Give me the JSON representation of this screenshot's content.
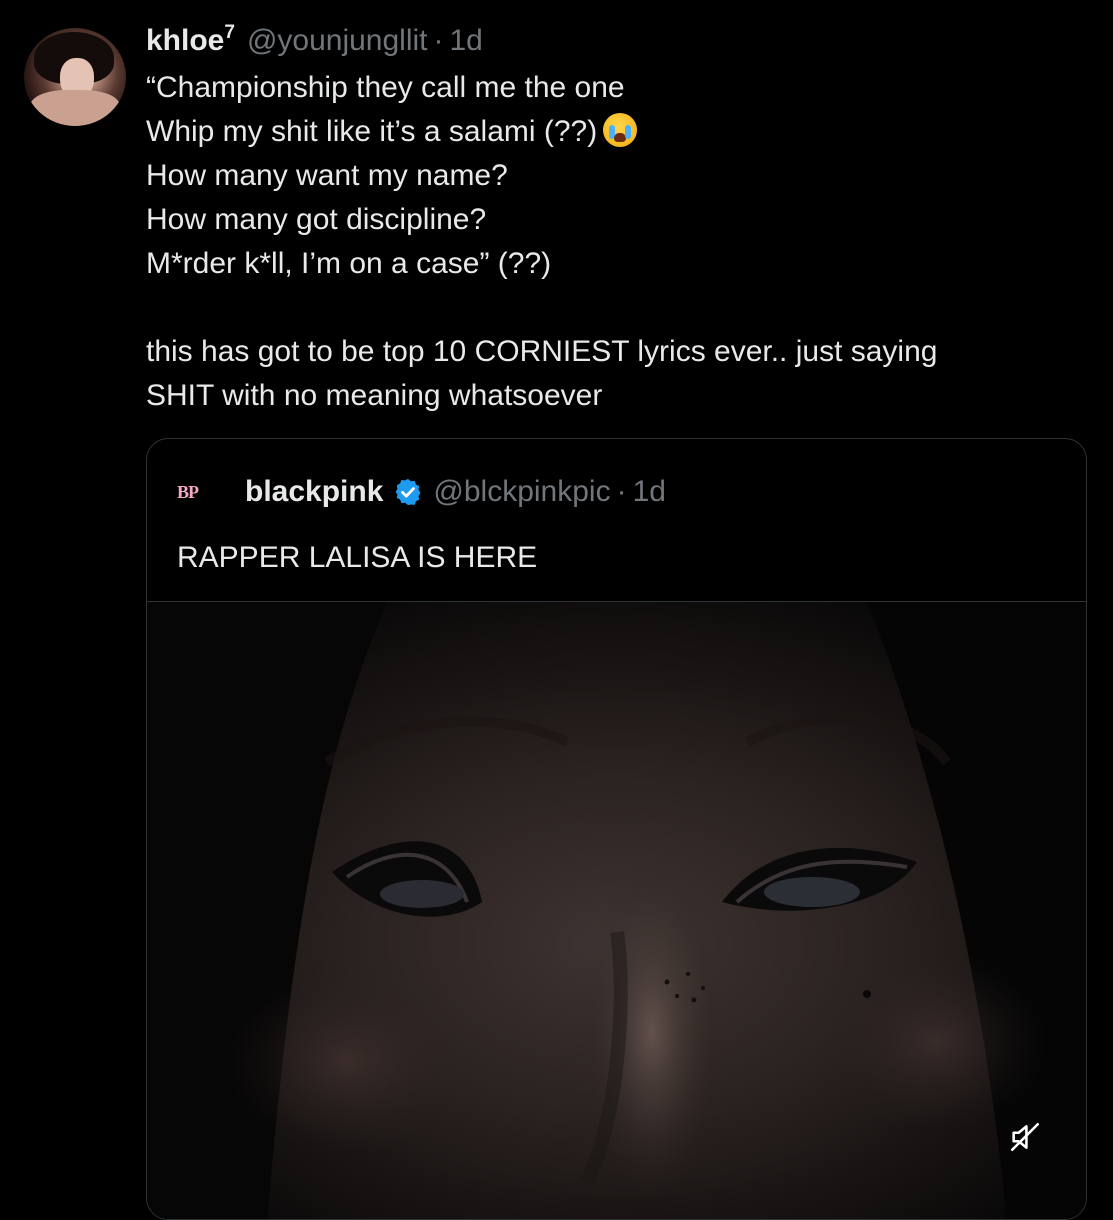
{
  "tweet": {
    "author": {
      "display_name": "khloe",
      "display_name_sup": "7",
      "handle": "@younjungllit",
      "separator": "·",
      "time": "1d",
      "avatar": "profile-photo"
    },
    "lines": [
      "“Championship they call me the one",
      "Whip my shit like it’s a salami (??)",
      "How many want my name?",
      "How many got discipline?",
      "M*rder k*ll, I’m on a case” (??)"
    ],
    "line2_emoji": "loudly-crying-face-emoji",
    "paragraph2": [
      "this has got to be top 10 CORNIEST lyrics ever.. just saying",
      "SHIT with no meaning whatsoever"
    ]
  },
  "quote": {
    "logo_text": "BP",
    "display_name": "blackpink",
    "verified_icon": "verified-badge-icon",
    "verified_color": "#1d9bf0",
    "handle": "@blckpinkpic",
    "separator": "·",
    "time": "1d",
    "text": "RAPPER LALISA IS HERE",
    "media": {
      "kind": "video",
      "description_icon": "video-thumbnail",
      "mute_icon": "muted-speaker-icon"
    }
  },
  "colors": {
    "background": "#000000",
    "primary_text": "#e7e9ea",
    "secondary_text": "#71767b",
    "border": "#2f3336",
    "logo_pink": "#f7a7c6"
  }
}
